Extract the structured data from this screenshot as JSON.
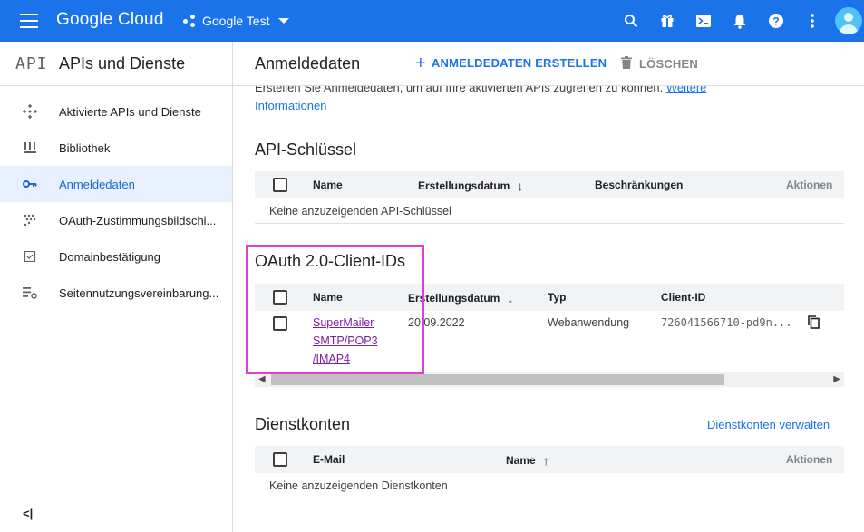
{
  "topbar": {
    "brand": "Google Cloud",
    "project": "Google Test",
    "icons": [
      "search-icon",
      "gift-icon",
      "terminal-icon",
      "bell-icon",
      "help-icon",
      "more-vert-icon"
    ],
    "accent_color": "#1a73e8"
  },
  "sidebar": {
    "logo": "API",
    "title": "APIs und Dienste",
    "items": [
      {
        "label": "Aktivierte APIs und Dienste",
        "icon": "diamond-dots-icon"
      },
      {
        "label": "Bibliothek",
        "icon": "library-icon"
      },
      {
        "label": "Anmeldedaten",
        "icon": "key-icon",
        "active": true
      },
      {
        "label": "OAuth-Zustimmungsbildschi...",
        "icon": "consent-dots-icon"
      },
      {
        "label": "Domainbestätigung",
        "icon": "checkbox-icon"
      },
      {
        "label": "Seitennutzungsvereinbarung...",
        "icon": "settings-list-icon"
      }
    ],
    "collapse": "<|"
  },
  "header": {
    "title": "Anmeldedaten",
    "create_label": "ANMELDEDATEN ERSTELLEN",
    "delete_label": "LÖSCHEN"
  },
  "intro": {
    "text": "Erstellen Sie Anmeldedaten, um auf Ihre aktivierten APIs zugreifen zu können.",
    "link1": "Weitere",
    "link2": "Informationen"
  },
  "api_keys": {
    "title": "API-Schlüssel",
    "columns": [
      "Name",
      "Erstellungsdatum",
      "Beschränkungen",
      "Aktionen"
    ],
    "empty": "Keine anzuzeigenden API-Schlüssel"
  },
  "oauth": {
    "title": "OAuth 2.0-Client-IDs",
    "columns": [
      "Name",
      "Erstellungsdatum",
      "Typ",
      "Client-ID"
    ],
    "rows": [
      {
        "name_line1": "SuperMailer",
        "name_line2": "SMTP/POP3",
        "name_line3": "/IMAP4",
        "date": "20.09.2022",
        "type": "Webanwendung",
        "client_id": "726041566710-pd9n..."
      }
    ]
  },
  "service_accounts": {
    "title": "Dienstkonten",
    "manage_link": "Dienstkonten verwalten",
    "columns": [
      "E-Mail",
      "Name",
      "Aktionen"
    ],
    "empty": "Keine anzuzeigenden Dienstkonten"
  }
}
